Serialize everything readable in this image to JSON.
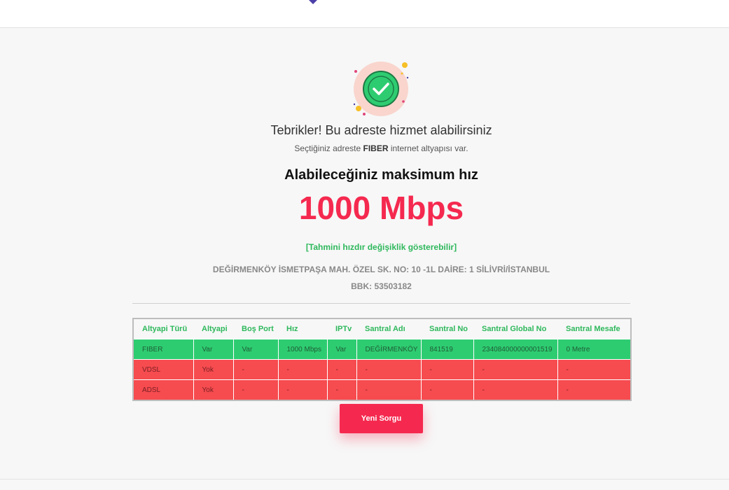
{
  "result": {
    "headline": "Tebrikler! Bu adreste hizmet alabilirsiniz",
    "sub_prefix": "Seçtiğiniz adreste",
    "sub_infra": "FIBER",
    "sub_suffix": "internet altyapısı var.",
    "max_speed_label": "Alabileceğiniz maksimum hız",
    "speed_value": "1000 Mbps",
    "speed_note": "[Tahmini hızdır değişiklik gösterebilir]",
    "address": "DEĞİRMENKÖY İSMETPAŞA MAH. ÖZEL SK. NO: 10 -1L DAİRE: 1 SİLİVRİ/İSTANBUL",
    "bbk": "BBK: 53503182"
  },
  "table": {
    "headers": [
      "Altyapi Türü",
      "Altyapi",
      "Boş Port",
      "Hız",
      "IPTv",
      "Santral Adı",
      "Santral No",
      "Santral Global No",
      "Santral Mesafe"
    ],
    "rows": [
      [
        "FIBER",
        "Var",
        "Var",
        "1000 Mbps",
        "Var",
        "DEĞİRMENKÖY",
        "841519",
        "234084000000001519",
        "0 Metre"
      ],
      [
        "VDSL",
        "Yok",
        "-",
        "-",
        "-",
        "-",
        "-",
        "-",
        "-"
      ],
      [
        "ADSL",
        "Yok",
        "-",
        "-",
        "-",
        "-",
        "-",
        "-",
        "-"
      ]
    ]
  },
  "actions": {
    "new_query_label": "Yeni Sorgu"
  },
  "colors": {
    "accent": "#f5294f",
    "success_green": "#2eb85c",
    "row_available": "#2ecc71",
    "row_unavailable": "#f64b4f"
  },
  "icons": {
    "success": "check-circle-icon"
  }
}
